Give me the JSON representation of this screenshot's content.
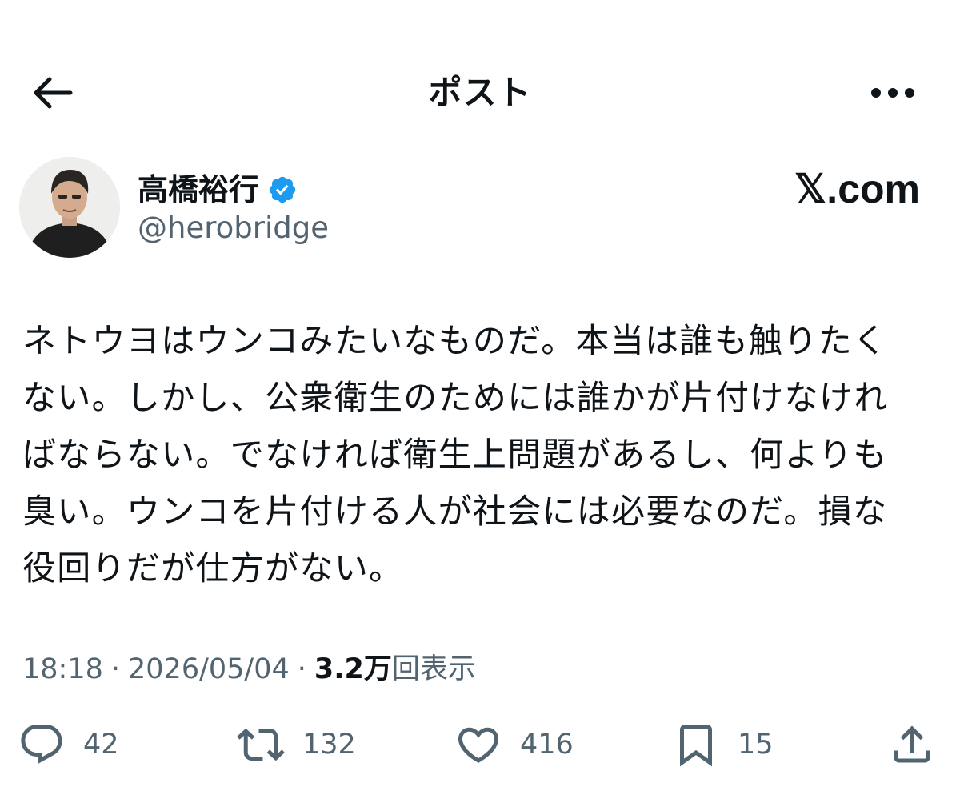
{
  "header": {
    "title": "ポスト",
    "back_icon": "arrow-left-icon",
    "more_icon": "more-horizontal-icon"
  },
  "author": {
    "name": "高橋裕行",
    "handle": "@herobridge",
    "verified_icon": "verified-badge-icon",
    "verified_color": "#1d9bf0"
  },
  "brand": {
    "text": "𝕏.com"
  },
  "post": {
    "text": "ネトウヨはウンコみたいなものだ。本当は誰も触りたく\nない。しかし、公衆衛生のためには誰かが片付けなけれ\nばならない。でなければ衛生上問題があるし、何よりも\n臭い。ウンコを片付ける人が社会には必要なのだ。損な\n役回りだが仕方がない。"
  },
  "meta": {
    "time": "18:18",
    "date": "2026/05/04",
    "views_value": "3.2万",
    "views_label": "回表示",
    "separator": "·"
  },
  "actions": {
    "reply": {
      "icon": "reply-icon",
      "count": "42"
    },
    "repost": {
      "icon": "repost-icon",
      "count": "132"
    },
    "like": {
      "icon": "heart-icon",
      "count": "416"
    },
    "bookmark": {
      "icon": "bookmark-icon",
      "count": "15"
    },
    "share": {
      "icon": "share-icon"
    }
  },
  "colors": {
    "text_primary": "#0f1419",
    "text_secondary": "#536471",
    "accent": "#1d9bf0"
  }
}
